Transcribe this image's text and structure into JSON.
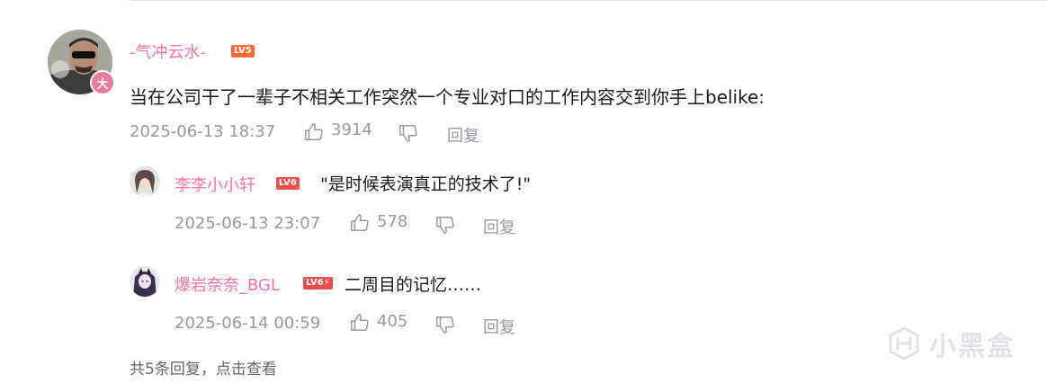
{
  "comment": {
    "username": "-气冲云水-",
    "level": "LV5",
    "badge": "大",
    "text": "当在公司干了一辈子不相关工作突然一个专业对口的工作内容交到你手上belike:",
    "timestamp": "2025-06-13 18:37",
    "likes": "3914",
    "reply_label": "回复"
  },
  "replies": [
    {
      "username": "李李小小轩",
      "level": "LV6",
      "text": "\"是时候表演真正的技术了!\"",
      "timestamp": "2025-06-13 23:07",
      "likes": "578",
      "reply_label": "回复"
    },
    {
      "username": "爆岩奈奈_BGL",
      "level": "LV6⚡",
      "text": "二周目的记忆……",
      "timestamp": "2025-06-14 00:59",
      "likes": "405",
      "reply_label": "回复"
    }
  ],
  "more_replies": "共5条回复，点击查看",
  "watermark": "小黑盒",
  "colors": {
    "username": "#fb7299",
    "level": "#ff6b35",
    "meta": "#9499a0",
    "text": "#18191c"
  },
  "icons": [
    "thumbs-up-icon",
    "thumbs-down-icon",
    "watermark-logo-icon"
  ]
}
